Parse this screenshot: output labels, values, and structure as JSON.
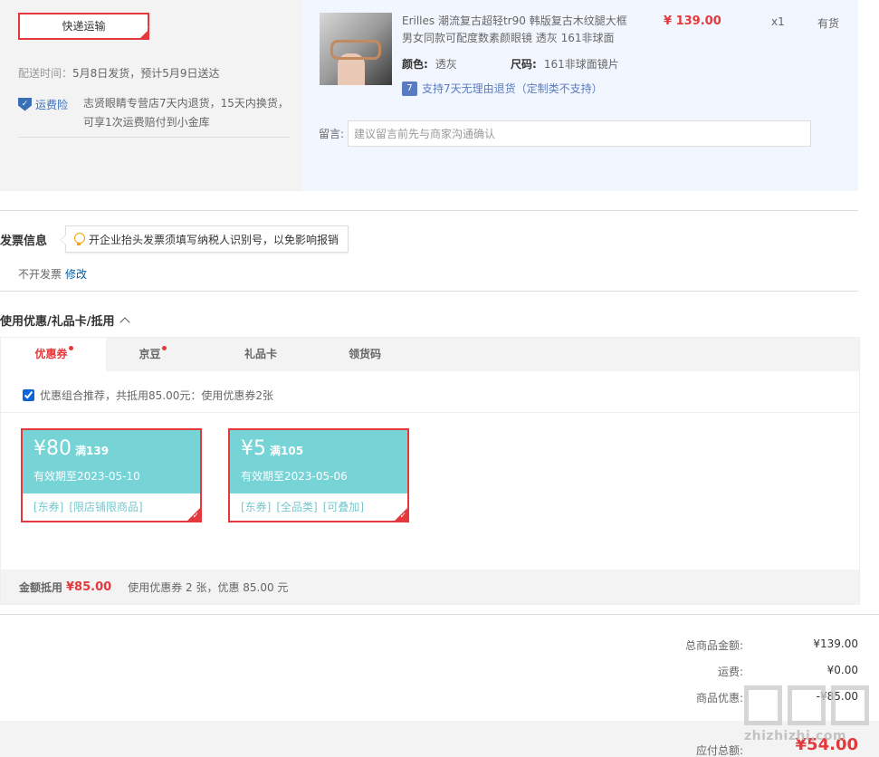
{
  "shipping": {
    "method_label": "快递运输",
    "delivery_label": "配送时间：",
    "delivery_value": "5月8日发货，预计5月9日送达",
    "freight_insurance_label": "运费险",
    "freight_insurance_desc": "志贤眼睛专营店7天内退货，15天内换货，可享1次运费赔付到小金库"
  },
  "product": {
    "title": "Erilles 潮流复古超轻tr90 韩版复古木纹腿大框男女同款可配度数素颜眼镜 透灰 161非球面",
    "price": "¥ 139.00",
    "quantity": "x1",
    "stock": "有货",
    "color_label": "颜色:",
    "color_value": "透灰",
    "size_label": "尺码:",
    "size_value": "161非球面镜片",
    "return_icon": "7",
    "return_text": "支持7天无理由退货（定制类不支持）",
    "message_label": "留言:",
    "message_placeholder": "建议留言前先与商家沟通确认"
  },
  "invoice": {
    "title": "发票信息",
    "tip": "开企业抬头发票须填写纳税人识别号，以免影响报销",
    "status": "不开发票",
    "edit_label": "修改"
  },
  "discount": {
    "title": "使用优惠/礼品卡/抵用",
    "tabs": [
      {
        "label": "优惠券",
        "active": true,
        "dot": true
      },
      {
        "label": "京豆",
        "active": false,
        "dot": true
      },
      {
        "label": "礼品卡",
        "active": false,
        "dot": false
      },
      {
        "label": "领货码",
        "active": false,
        "dot": false
      }
    ],
    "combo_checked": true,
    "combo_text": "优惠组合推荐，共抵用85.00元：使用优惠券2张",
    "coupons": [
      {
        "amount": "¥80",
        "condition": "满139",
        "expiry": "有效期至2023-05-10",
        "tags": [
          "[东券]",
          "[限店铺限商品]"
        ],
        "selected": true
      },
      {
        "amount": "¥5",
        "condition": "满105",
        "expiry": "有效期至2023-05-06",
        "tags": [
          "[东券]",
          "[全品类]",
          "[可叠加]"
        ],
        "selected": true
      }
    ],
    "footer_label": "金额抵用",
    "footer_amount": "¥85.00",
    "footer_desc": "使用优惠券 2 张，优惠 85.00 元"
  },
  "totals": {
    "goods_label": "总商品金额:",
    "goods_value": "¥139.00",
    "freight_label": "运费:",
    "freight_value": "¥0.00",
    "discount_label": "商品优惠:",
    "discount_value": "-¥85.00",
    "payable_label": "应付总额:",
    "payable_value": "¥54.00"
  },
  "watermark": {
    "text": "zhizhizhi.com"
  },
  "colors": {
    "accent_red": "#e4393c",
    "coupon_teal": "#76d3d6",
    "link_blue": "#005ea7"
  }
}
